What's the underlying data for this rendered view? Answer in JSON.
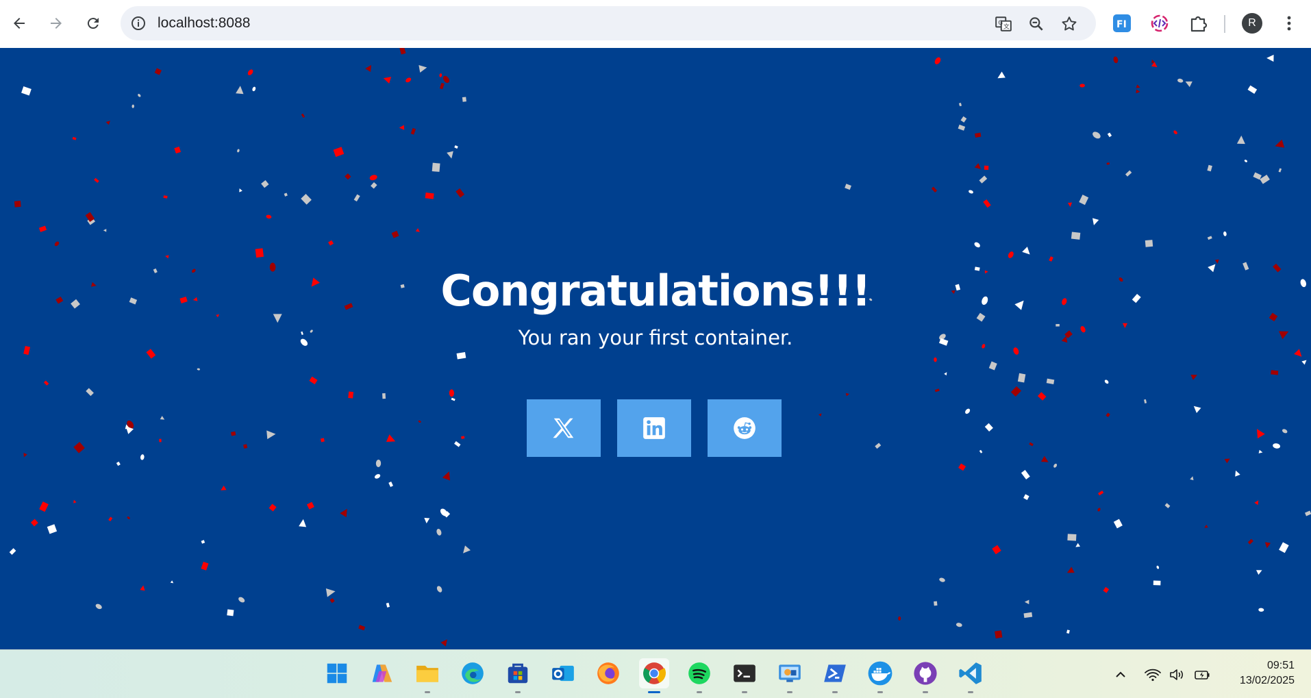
{
  "browser": {
    "url": "localhost:8088",
    "profile_initial": "R",
    "icons": [
      "back-icon",
      "forward-icon",
      "reload-icon",
      "site-info-icon",
      "translate-icon",
      "zoom-icon",
      "bookmark-star-icon",
      "extension-fi-icon",
      "extension-code-icon",
      "extensions-puzzle-icon",
      "menu-kebab-icon"
    ],
    "extension_fi_label": "FI"
  },
  "page": {
    "title": "Congratulations!!!",
    "subtitle": "You ran your first container.",
    "share_buttons": [
      "x-twitter",
      "linkedin",
      "reddit"
    ],
    "colors": {
      "background": "#00408f",
      "button": "#53a3ec",
      "confetti": [
        "#ffffff",
        "#c8c8c8",
        "#ff0000",
        "#a00000"
      ]
    }
  },
  "taskbar": {
    "apps": [
      "windows-start",
      "copilot",
      "file-explorer",
      "edge",
      "microsoft-store",
      "outlook",
      "firefox",
      "chrome",
      "spotify",
      "terminal",
      "remote-desktop",
      "powershell",
      "docker",
      "github-desktop",
      "vscode"
    ],
    "active_app": "chrome",
    "time": "09:51",
    "date": "13/02/2025"
  }
}
